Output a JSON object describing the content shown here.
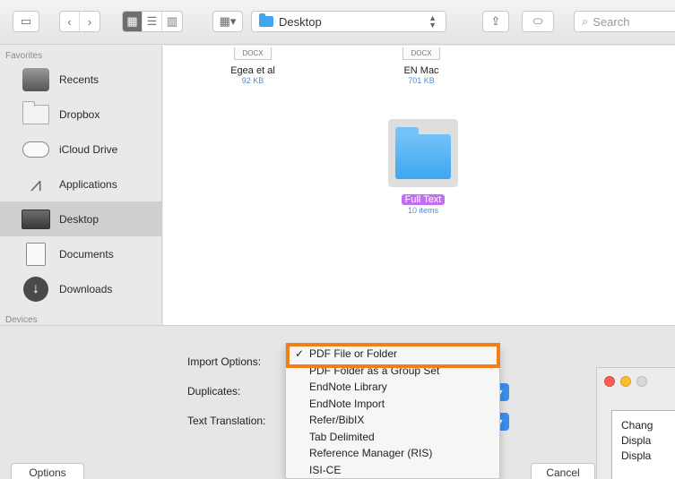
{
  "toolbar": {
    "back_icon": "chevron-left",
    "forward_icon": "chevron-right",
    "path_label": "Desktop",
    "search_placeholder": "Search"
  },
  "sidebar": {
    "section_favorites": "Favorites",
    "items": [
      {
        "label": "Recents",
        "icon": "recents-icon"
      },
      {
        "label": "Dropbox",
        "icon": "folder-icon"
      },
      {
        "label": "iCloud Drive",
        "icon": "cloud-icon"
      },
      {
        "label": "Applications",
        "icon": "applications-icon"
      },
      {
        "label": "Desktop",
        "icon": "desktop-icon",
        "selected": true
      },
      {
        "label": "Documents",
        "icon": "document-icon"
      },
      {
        "label": "Downloads",
        "icon": "download-icon"
      }
    ],
    "section_devices": "Devices"
  },
  "files": [
    {
      "type_tag": "DOCX",
      "name": "Egea et al",
      "size": "92 KB"
    },
    {
      "type_tag": "DOCX",
      "name": "EN Mac",
      "size": "701 KB"
    }
  ],
  "selected_folder": {
    "name": "Full Text",
    "items": "10 items"
  },
  "options": {
    "import_label": "Import Options:",
    "duplicates_label": "Duplicates:",
    "translation_label": "Text Translation:"
  },
  "menu": {
    "items": [
      {
        "label": "PDF File or Folder",
        "checked": true
      },
      {
        "label": "PDF Folder as a Group Set"
      },
      {
        "label": "EndNote Library"
      },
      {
        "label": "EndNote Import"
      },
      {
        "label": "Refer/BibIX"
      },
      {
        "label": "Tab Delimited"
      },
      {
        "label": "Reference Manager (RIS)"
      },
      {
        "label": "ISI-CE"
      }
    ],
    "check_glyph": "✓"
  },
  "buttons": {
    "options": "Options",
    "cancel": "Cancel"
  },
  "secondary_window": {
    "lines": [
      "Chang",
      "Displa",
      "Displa"
    ]
  },
  "colors": {
    "accent": "#3b8ef0",
    "highlight_border": "#f07f18",
    "folder_tag": "#c26ef0",
    "folder_blue": "#3fa6f2"
  }
}
